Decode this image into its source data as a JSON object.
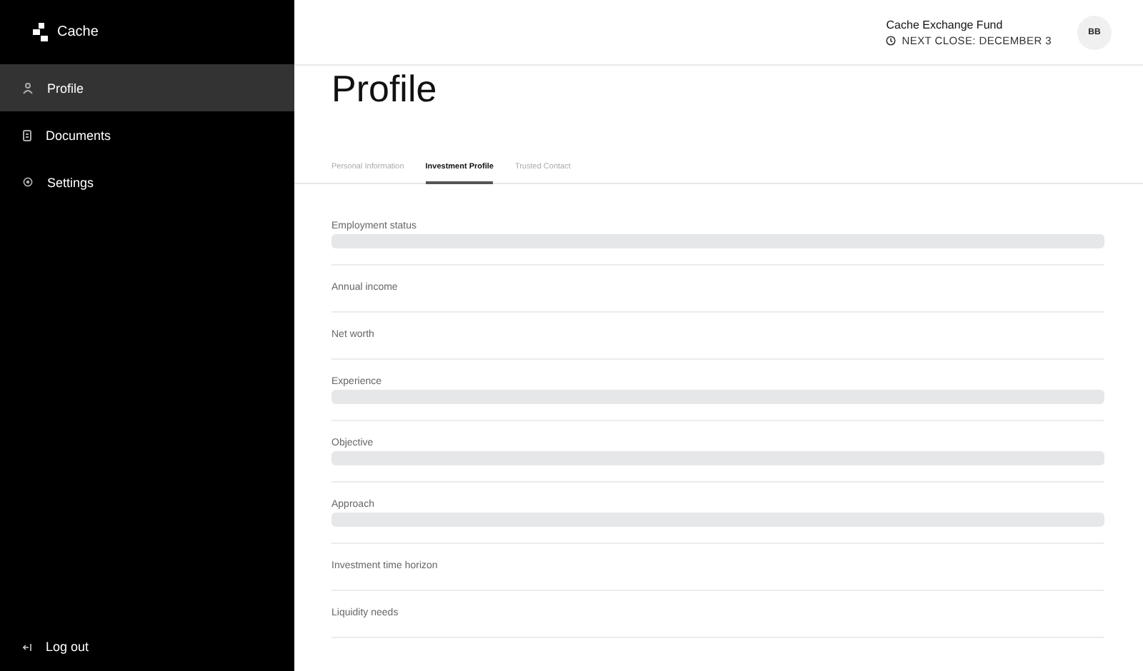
{
  "sidebar": {
    "brand": "Cache",
    "items": [
      {
        "label": "Profile",
        "kind": "person",
        "selected": true
      },
      {
        "label": "Documents",
        "kind": "document",
        "selected": false
      },
      {
        "label": "Settings",
        "kind": "gear",
        "selected": false
      }
    ],
    "logout": "Log out"
  },
  "header": {
    "fund": "Cache Exchange Fund",
    "next_close": "NEXT CLOSE: DECEMBER 3",
    "avatar": "BB"
  },
  "page_title": "Profile",
  "tabs": [
    {
      "label": "Personal Information",
      "selected": false
    },
    {
      "label": "Investment Profile",
      "selected": true
    },
    {
      "label": "Trusted Contact",
      "selected": false
    }
  ],
  "fields": [
    {
      "label": "Employment status",
      "kind": "loading"
    },
    {
      "label": "Annual income",
      "kind": "empty"
    },
    {
      "label": "Net worth",
      "kind": "empty"
    },
    {
      "label": "Experience",
      "kind": "loading"
    },
    {
      "label": "Objective",
      "kind": "loading"
    },
    {
      "label": "Approach",
      "kind": "loading"
    },
    {
      "label": "Investment time horizon",
      "kind": "empty"
    },
    {
      "label": "Liquidity needs",
      "kind": "empty"
    }
  ]
}
